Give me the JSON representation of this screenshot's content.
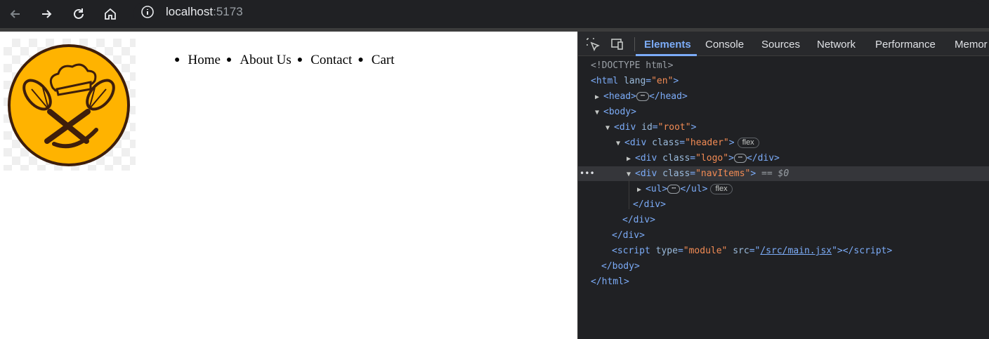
{
  "browser": {
    "url_host": "localhost",
    "url_port": ":5173"
  },
  "page": {
    "nav_items": [
      "Home",
      "About Us",
      "Contact",
      "Cart"
    ],
    "logo_colors": {
      "fill": "#FFB300",
      "outline": "#3E1E0B"
    }
  },
  "devtools": {
    "tabs": [
      "Elements",
      "Console",
      "Sources",
      "Network",
      "Performance",
      "Memor"
    ],
    "active_tab": "Elements",
    "dom": {
      "doctype": "<!DOCTYPE html>",
      "html_open": "html",
      "html_attr": "lang",
      "html_val": "\"en\"",
      "head": "head",
      "body": "body",
      "div": "div",
      "id_attr": "id",
      "root_val": "\"root\"",
      "class_attr": "class",
      "header_val": "\"header\"",
      "logo_val": "\"logo\"",
      "navitems_val": "\"navItems\"",
      "ul": "ul",
      "flex_badge": "flex",
      "selected_marker": "== $0",
      "script": "script",
      "type_attr": "type",
      "module_val": "\"module\"",
      "src_attr": "src",
      "src_val": "/src/main.jsx",
      "ellipsis": "⋯",
      "row_dots": "•••"
    }
  }
}
